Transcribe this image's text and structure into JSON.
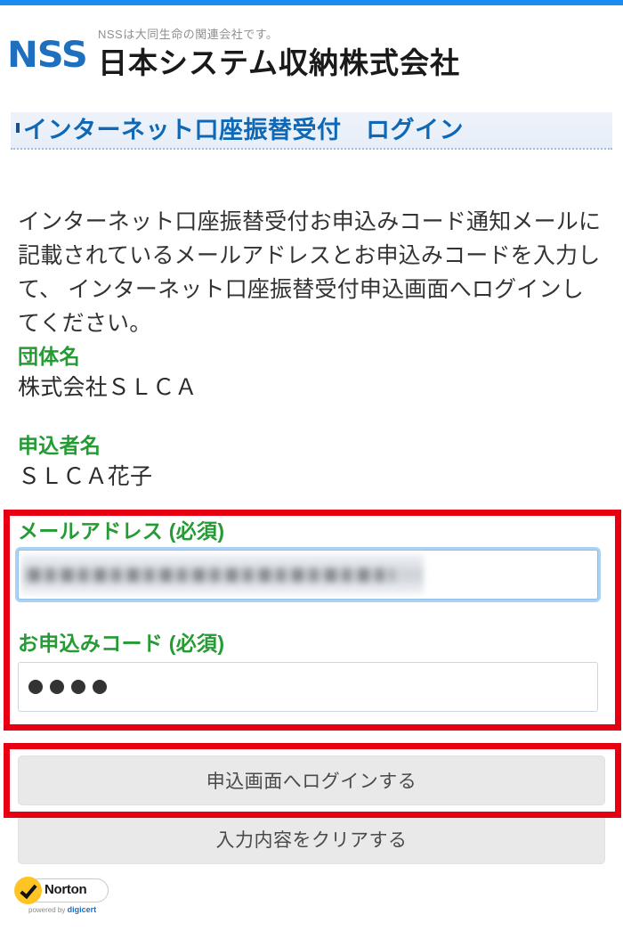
{
  "theme": {
    "accent_blue": "#1a8cf0",
    "title_blue": "#0f68b5",
    "label_green": "#259b34",
    "annotation_red": "#e60012",
    "button_gray": "#e9e9e9"
  },
  "header": {
    "logo_mark": "NSS",
    "tagline": "NSSは大同生命の関連会社です。",
    "company_name": "日本システム収納株式会社"
  },
  "page_title": "インターネット口座振替受付　ログイン",
  "lead_text": "インターネット口座振替受付お申込みコード通知メールに記載されているメールアドレスとお申込みコードを入力して、 インターネット口座振替受付申込画面へログインしてください。",
  "info_fields": [
    {
      "label": "団体名",
      "value": "株式会社ＳＬＣＡ"
    },
    {
      "label": "申込者名",
      "value": "ＳＬＣＡ花子"
    }
  ],
  "form": {
    "email": {
      "label": "メールアドレス (必須)",
      "value": "",
      "placeholder": "",
      "redacted": true,
      "focused": true
    },
    "code": {
      "label": "お申込みコード (必須)",
      "masked_value": "●●●●",
      "mask_count": 4,
      "placeholder": ""
    }
  },
  "buttons": {
    "login": "申込画面へログインする",
    "clear": "入力内容をクリアする"
  },
  "seal": {
    "brand": "Norton",
    "powered_by": "powered by ",
    "provider": "digicert",
    "check_icon": "check-icon"
  }
}
